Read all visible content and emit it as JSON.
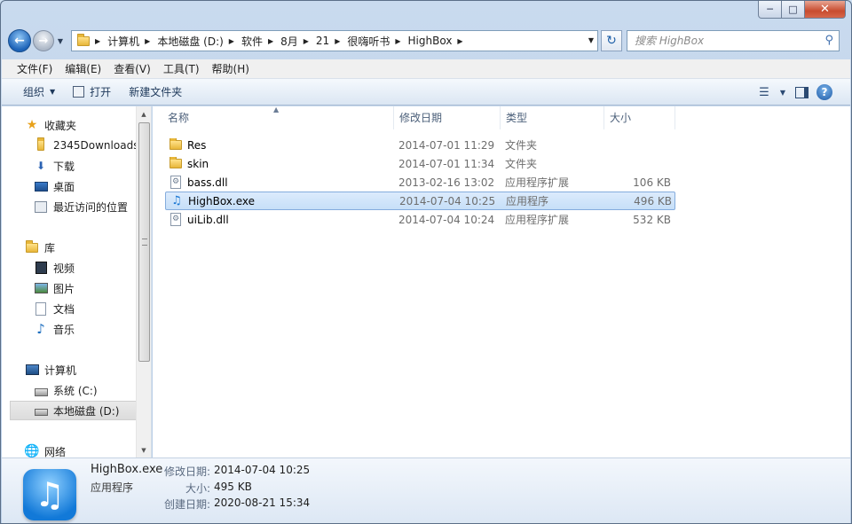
{
  "window": {
    "caption_buttons": {
      "minimize": "─",
      "maximize": "□",
      "close": "✕"
    }
  },
  "address": {
    "crumbs": [
      "计算机",
      "本地磁盘 (D:)",
      "软件",
      "8月",
      "21",
      "很嗨听书",
      "HighBox"
    ]
  },
  "search": {
    "placeholder": "搜索 HighBox"
  },
  "menu": [
    "文件(F)",
    "编辑(E)",
    "查看(V)",
    "工具(T)",
    "帮助(H)"
  ],
  "toolbar": {
    "organize": "组织",
    "open": "打开",
    "new_folder": "新建文件夹"
  },
  "nav": {
    "favorites": "收藏夹",
    "fav_items": [
      "2345Downloads",
      "下载",
      "桌面",
      "最近访问的位置"
    ],
    "libraries": "库",
    "lib_items": [
      "视频",
      "图片",
      "文档",
      "音乐"
    ],
    "computer": "计算机",
    "comp_items": [
      "系统 (C:)",
      "本地磁盘 (D:)"
    ],
    "network": "网络"
  },
  "columns": {
    "name": "名称",
    "date": "修改日期",
    "type": "类型",
    "size": "大小"
  },
  "files": [
    {
      "name": "Res",
      "date": "2014-07-01 11:29",
      "type": "文件夹",
      "size": "",
      "icon": "folder-icon"
    },
    {
      "name": "skin",
      "date": "2014-07-01 11:34",
      "type": "文件夹",
      "size": "",
      "icon": "folder-icon"
    },
    {
      "name": "bass.dll",
      "date": "2013-02-16 13:02",
      "type": "应用程序扩展",
      "size": "106 KB",
      "icon": "dll-file-icon"
    },
    {
      "name": "HighBox.exe",
      "date": "2014-07-04 10:25",
      "type": "应用程序",
      "size": "496 KB",
      "icon": "music-app-icon"
    },
    {
      "name": "uiLib.dll",
      "date": "2014-07-04 10:24",
      "type": "应用程序扩展",
      "size": "532 KB",
      "icon": "dll-file-icon"
    }
  ],
  "details": {
    "name": "HighBox.exe",
    "kind": "应用程序",
    "modified_label": "修改日期:",
    "modified": "2014-07-04 10:25",
    "size_label": "大小:",
    "size": "495 KB",
    "created_label": "创建日期:",
    "created": "2020-08-21 15:34"
  },
  "colors": {
    "selection": "#cce4fb",
    "accent": "#1d63b8"
  }
}
